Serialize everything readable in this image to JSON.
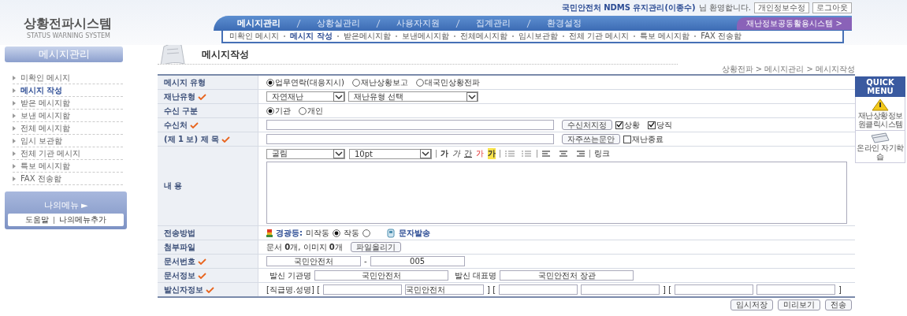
{
  "header": {
    "logo_title": "상황전파시스템",
    "logo_subtitle": "STATUS WARNING SYSTEM",
    "welcome_user": "국민안전처 NDMS 유지관리(이종수)",
    "welcome_suffix": "님 환영합니다.",
    "buttons": [
      "개인정보수정",
      "로그아웃"
    ]
  },
  "main_tabs": [
    {
      "label": "메시지관리",
      "selected": true
    },
    {
      "label": "상황실관리",
      "selected": false
    },
    {
      "label": "사용자지원",
      "selected": false
    },
    {
      "label": "집계관리",
      "selected": false
    },
    {
      "label": "환경설정",
      "selected": false
    }
  ],
  "external_tab": "재난정보공동활용시스템 >",
  "sub_tabs": [
    {
      "label": "미확인 메시지",
      "selected": false
    },
    {
      "label": "메시지 작성",
      "selected": true
    },
    {
      "label": "받은메시지함",
      "selected": false
    },
    {
      "label": "보낸메시지함",
      "selected": false
    },
    {
      "label": "전체메시지함",
      "selected": false
    },
    {
      "label": "임시보관함",
      "selected": false
    },
    {
      "label": "전체 기관 메시지",
      "selected": false
    },
    {
      "label": "특보 메시지함",
      "selected": false
    },
    {
      "label": "FAX 전송함",
      "selected": false
    }
  ],
  "sidebar": {
    "title": "메시지관리",
    "items": [
      {
        "label": "미확인 메시지",
        "selected": false
      },
      {
        "label": "메시지 작성",
        "selected": true
      },
      {
        "label": "받은 메시지함",
        "selected": false
      },
      {
        "label": "보낸 메시지함",
        "selected": false
      },
      {
        "label": "전체 메시지함",
        "selected": false
      },
      {
        "label": "임시 보관함",
        "selected": false
      },
      {
        "label": "전체 기관 메시지",
        "selected": false
      },
      {
        "label": "특보 메시지함",
        "selected": false
      },
      {
        "label": "FAX 전송함",
        "selected": false
      }
    ],
    "my_menu": "나의메뉴 ►",
    "links": [
      "도움말",
      "나의메뉴추가"
    ]
  },
  "page": {
    "title": "메시지작성",
    "breadcrumb": "상황전파 > 메시지관리 > 메시지작성"
  },
  "form": [
    {
      "kind": "radios",
      "label": "메시지 유형",
      "required": false,
      "options": [
        {
          "label": "업무연락(대응지시)",
          "selected": true
        },
        {
          "label": "재난상황보고",
          "selected": false
        },
        {
          "label": "대국민상황전파",
          "selected": false
        }
      ]
    },
    {
      "kind": "selects",
      "label": "재난유형",
      "required": true,
      "selects": [
        "자연재난",
        "재난유형 선택"
      ]
    },
    {
      "kind": "radios",
      "label": "수신 구분",
      "required": false,
      "options": [
        {
          "label": "기관",
          "selected": true
        },
        {
          "label": "개인",
          "selected": false
        }
      ]
    },
    {
      "kind": "input_button",
      "label": "수신처",
      "required": true,
      "button": "수신처지정",
      "checks": [
        {
          "label": "상황",
          "checked": true
        },
        {
          "label": "당직",
          "checked": true
        }
      ]
    },
    {
      "kind": "input_button",
      "label": "(제 1 보) 제 목",
      "required": true,
      "button": "자주쓰는문안",
      "checks": [
        {
          "label": "재난종료",
          "checked": false
        }
      ]
    },
    {
      "kind": "editor",
      "label": "내 용",
      "required": false,
      "font": "굴림",
      "size": "10pt",
      "tools": [
        {
          "kind": "bold",
          "label": "가"
        },
        {
          "kind": "italic",
          "label": "가"
        },
        {
          "kind": "underline",
          "label": "간"
        },
        {
          "kind": "color",
          "label": "가"
        },
        {
          "kind": "highlight",
          "label": "가"
        }
      ],
      "link": "링크"
    },
    {
      "kind": "send",
      "label": "전송방법",
      "required": false,
      "light_label": "경광등:",
      "options": [
        {
          "label": "미작동",
          "selected": true
        },
        {
          "label": "작동",
          "selected": false
        }
      ],
      "sms": "문자발송"
    },
    {
      "kind": "attach",
      "label": "첨부파일",
      "required": false,
      "text": "문서 **0**개, 이미지 **0**개",
      "button": "파일올리기"
    },
    {
      "kind": "docnum",
      "label": "문서번호",
      "required": true,
      "values": [
        "국민안전처",
        "005"
      ],
      "separator": "-"
    },
    {
      "kind": "docinfo",
      "label": "문서정보",
      "required": true,
      "fields": [
        {
          "label": "발신 기관명",
          "value": "국민안전처"
        },
        {
          "label": "발신 대표명",
          "value": "국민안전처 장관"
        }
      ]
    },
    {
      "kind": "sender",
      "label": "발신자정보",
      "required": true,
      "segments": [
        {
          "kind": "text",
          "text": "[직급명.성명] ["
        },
        {
          "kind": "input"
        },
        {
          "kind": "input",
          "value": "국민안전처"
        },
        {
          "kind": "text",
          "text": "] ["
        },
        {
          "kind": "input"
        },
        {
          "kind": "input"
        },
        {
          "kind": "text",
          "text": "] ["
        },
        {
          "kind": "input"
        },
        {
          "kind": "input"
        },
        {
          "kind": "text",
          "text": "]"
        }
      ]
    }
  ],
  "footer_buttons": [
    "임시저장",
    "미리보기",
    "전송"
  ],
  "quick_menu": {
    "title": "QUICK MENU",
    "items": [
      "재난상황정보 원클릭시스템",
      "온라인 자기학습"
    ]
  }
}
